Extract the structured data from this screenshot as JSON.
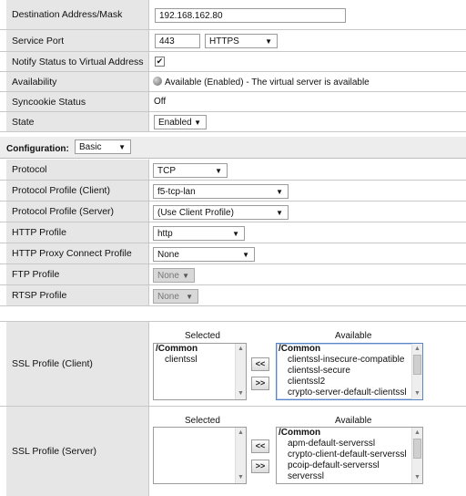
{
  "properties": {
    "destination": {
      "label": "Destination Address/Mask",
      "value": "192.168.162.80"
    },
    "service_port": {
      "label": "Service Port",
      "port": "443",
      "protocol": "HTTPS"
    },
    "notify": {
      "label": "Notify Status to Virtual Address",
      "check": "✔"
    },
    "availability": {
      "label": "Availability",
      "value": "Available (Enabled) - The virtual server is available"
    },
    "syncookie": {
      "label": "Syncookie Status",
      "value": "Off"
    },
    "state": {
      "label": "State",
      "value": "Enabled"
    }
  },
  "configuration": {
    "title": "Configuration:",
    "mode": "Basic",
    "rows": [
      {
        "label": "Protocol",
        "value": "TCP"
      },
      {
        "label": "Protocol Profile (Client)",
        "value": "f5-tcp-lan"
      },
      {
        "label": "Protocol Profile (Server)",
        "value": "(Use Client Profile)"
      },
      {
        "label": "HTTP Profile",
        "value": "http"
      },
      {
        "label": "HTTP Proxy Connect Profile",
        "value": "None"
      },
      {
        "label": "FTP Profile",
        "value": "None"
      },
      {
        "label": "RTSP Profile",
        "value": "None"
      }
    ]
  },
  "ssl_client": {
    "label": "SSL Profile (Client)",
    "selected_heading": "Selected",
    "available_heading": "Available",
    "selected_group": "/Common",
    "selected_items": [
      "clientssl"
    ],
    "available_group": "/Common",
    "available_items": [
      "clientssl-insecure-compatible",
      "clientssl-secure",
      "clientssl2",
      "crypto-server-default-clientssl"
    ]
  },
  "ssl_server": {
    "label": "SSL Profile (Server)",
    "selected_heading": "Selected",
    "available_heading": "Available",
    "available_group": "/Common",
    "available_items": [
      "apm-default-serverssl",
      "crypto-client-default-serverssl",
      "pcoip-default-serverssl",
      "serverssl"
    ]
  },
  "buttons": {
    "move_left": "<<",
    "move_right": ">>"
  },
  "icons": {
    "dropdown": "▼",
    "scroll_up": "▲",
    "scroll_down": "▼"
  }
}
